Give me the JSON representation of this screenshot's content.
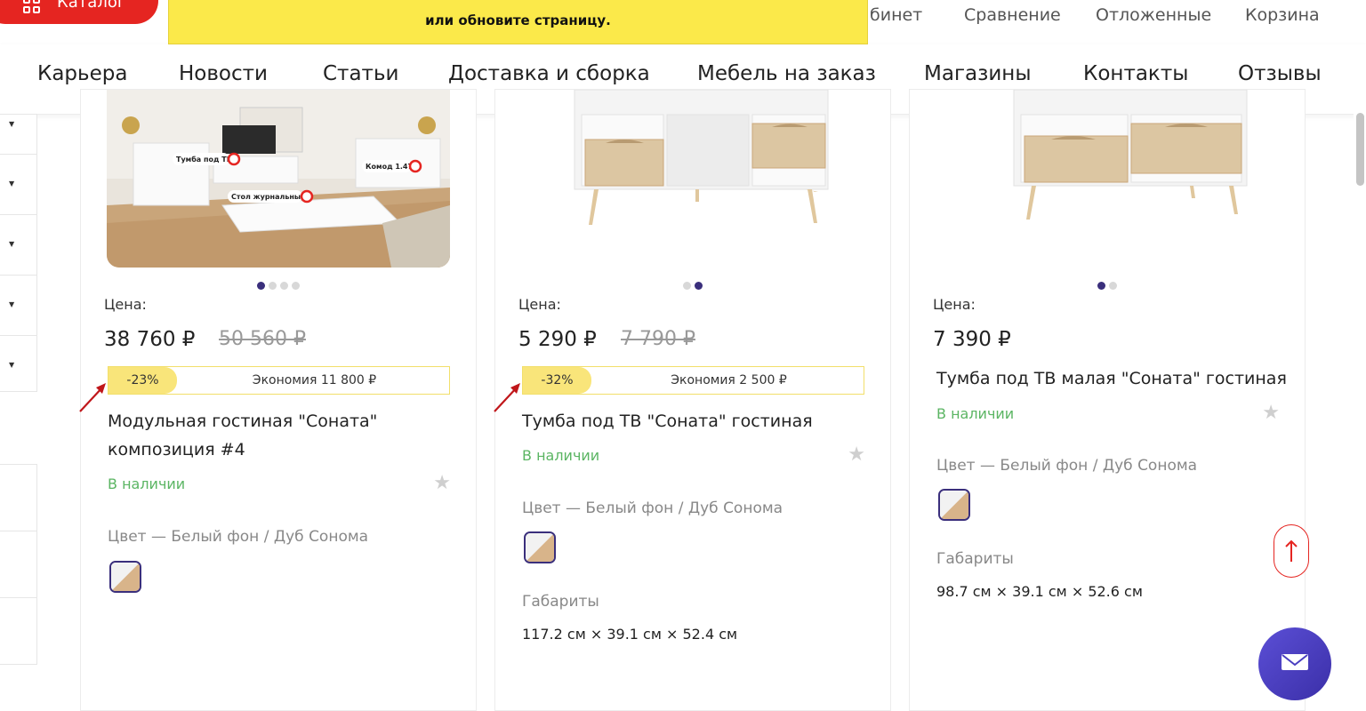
{
  "header": {
    "catalog_label": "Каталог",
    "notice_text": "или обновите страницу.",
    "top_links": [
      "бинет",
      "Сравнение",
      "Отложенные",
      "Корзина"
    ],
    "nav": [
      "Карьера",
      "Новости",
      "Статьи",
      "Доставка и сборка",
      "Мебель на заказ",
      "Магазины",
      "Контакты",
      "Отзывы"
    ]
  },
  "products": [
    {
      "price_label": "Цена:",
      "price": "38 760 ₽",
      "old_price": "50 560 ₽",
      "discount": "-23%",
      "saving": "Экономия 11 800 ₽",
      "title": "Модульная гостиная \"Соната\" композиция #4",
      "stock": "В наличии",
      "color": "Цвет  —  Белый фон / Дуб Сонома",
      "image_tags": [
        "Тумба под ТВ",
        "Комод 1.47",
        "Стол журнальный"
      ],
      "dots": 4,
      "active_dot": 0
    },
    {
      "price_label": "Цена:",
      "price": "5 290 ₽",
      "old_price": "7 790 ₽",
      "discount": "-32%",
      "saving": "Экономия 2 500 ₽",
      "title": "Тумба под ТВ \"Соната\" гостиная",
      "stock": "В наличии",
      "color": "Цвет  —  Белый фон / Дуб Сонома",
      "dims_label": "Габариты",
      "dims": "117.2 см  ×  39.1 см  ×  52.4 см",
      "dots": 2,
      "active_dot": 1
    },
    {
      "price_label": "Цена:",
      "price": "7 390 ₽",
      "title": "Тумба под ТВ малая \"Соната\" гостиная",
      "stock": "В наличии",
      "color": "Цвет  —  Белый фон / Дуб Сонома",
      "dims_label": "Габариты",
      "dims": "98.7 см  ×  39.1 см  ×  52.6 см",
      "dots": 2,
      "active_dot": 0
    }
  ],
  "colors": {
    "brand_red": "#e52521",
    "notice_yellow": "#fbe94a",
    "accent_purple": "#3a2f7c",
    "in_stock_green": "#5bb563"
  }
}
